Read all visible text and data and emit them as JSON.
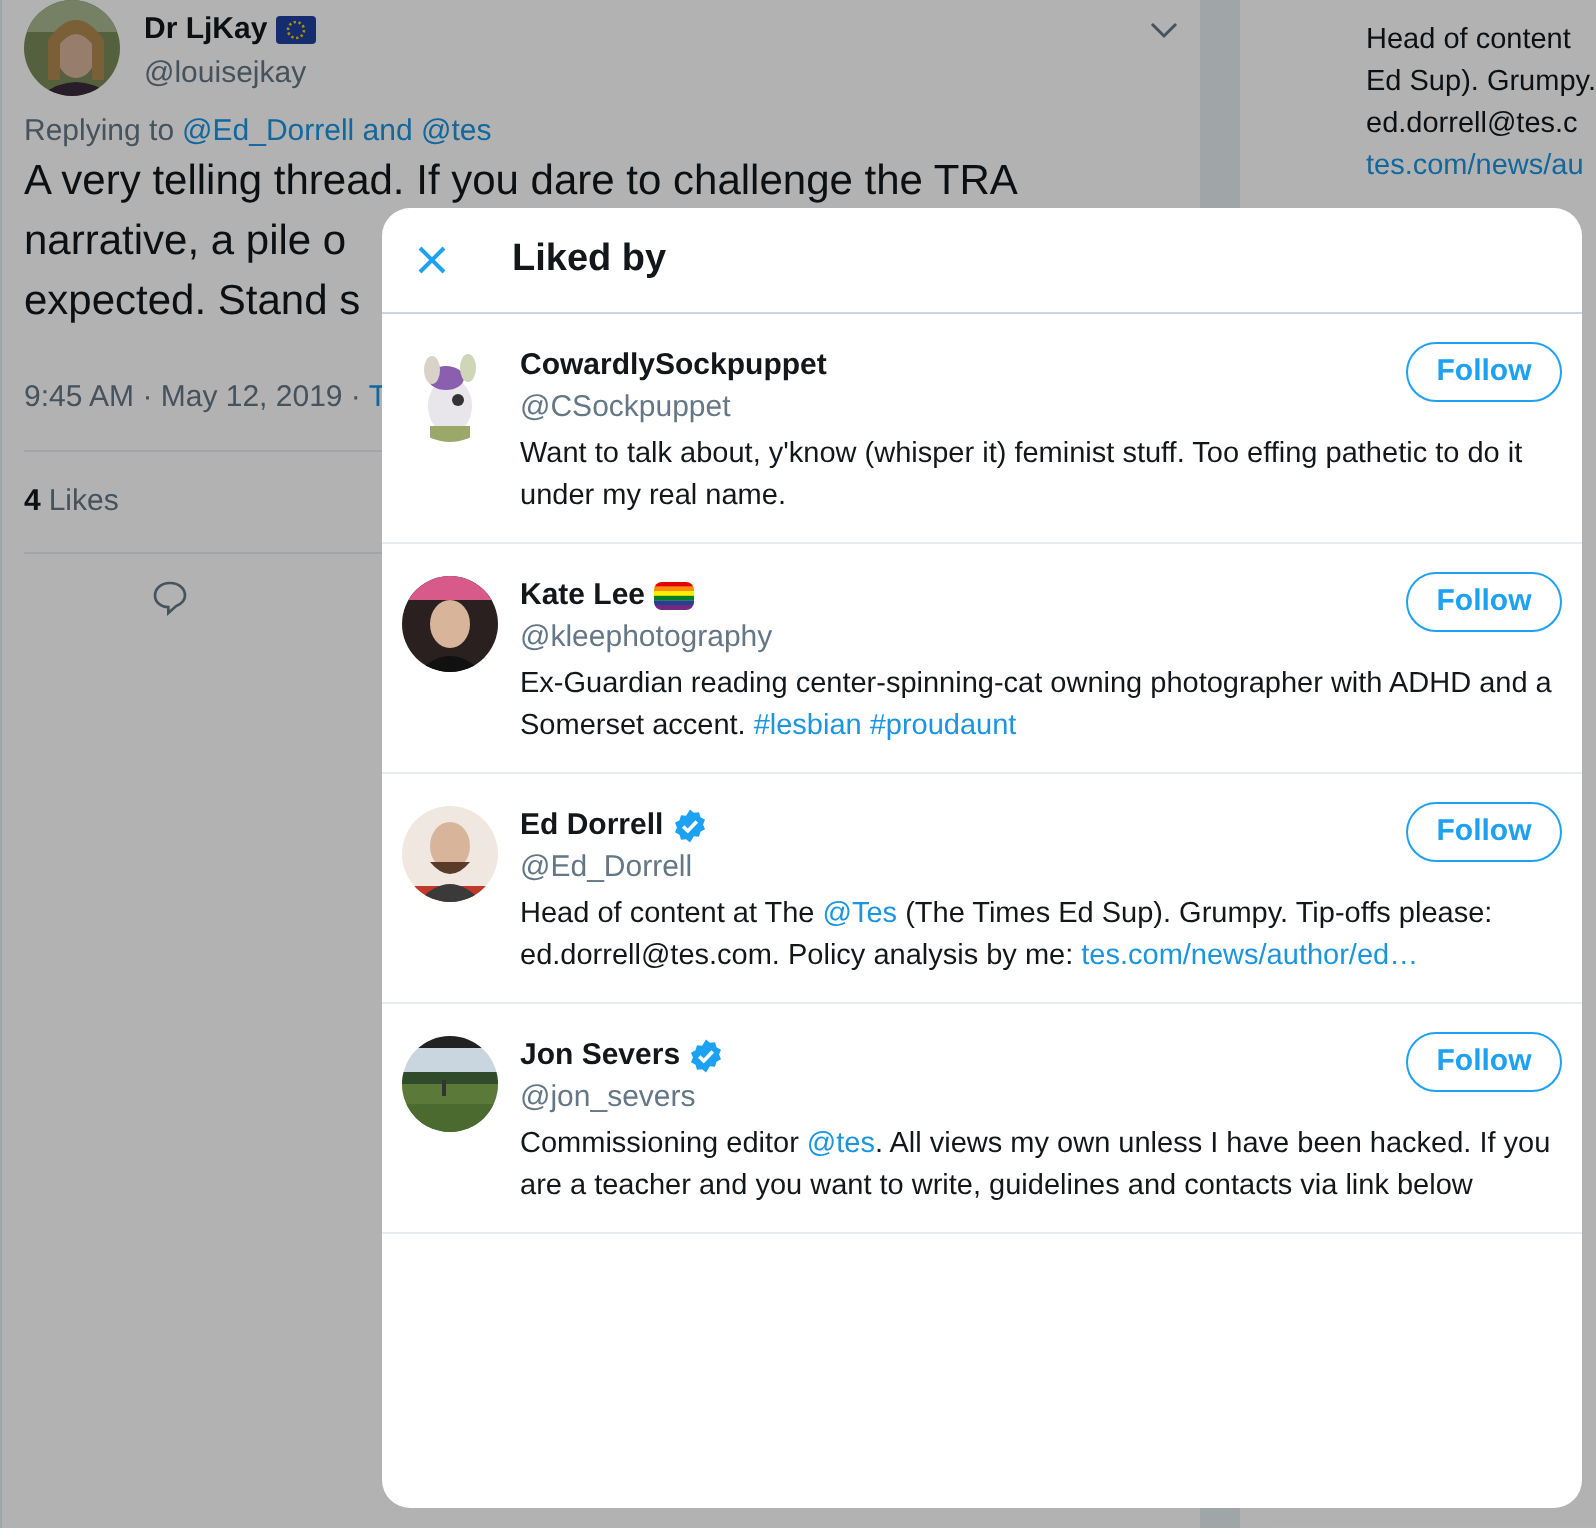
{
  "background_tweet": {
    "author": {
      "name": "Dr LjKay",
      "handle": "@louisejkay"
    },
    "replying_prefix": "Replying to",
    "replying_to": "@Ed_Dorrell and @tes",
    "text_lines": [
      "A very telling thread. If you dare to challenge the TRA",
      "narrative, a pile o",
      "expected. Stand s"
    ],
    "meta": "9:45 AM · May 12, 2019 ·",
    "source": "T",
    "likes_count": "4",
    "likes_label": "Likes"
  },
  "right_column": {
    "lines": [
      "Head of content",
      "Ed Sup). Grumpy.",
      "ed.dorrell@tes.c"
    ],
    "link": "tes.com/news/au"
  },
  "modal": {
    "title": "Liked by",
    "users": [
      {
        "name": "CowardlySockpuppet",
        "handle": "@CSockpuppet",
        "verified": false,
        "button": "Follow",
        "bio": [
          {
            "text": "Want to talk about, y'know (whisper it) feminist stuff. Too effing pathetic to do it under my real name.",
            "link": false
          }
        ]
      },
      {
        "name": "Kate Lee",
        "handle": "@kleephotography",
        "verified": false,
        "button": "Follow",
        "bio": [
          {
            "text": "Ex-Guardian reading center-spinning-cat owning photographer with ADHD and a Somerset accent.",
            "link": false
          },
          {
            "text": "#lesbian",
            "link": true
          },
          {
            "text": "#proudaunt",
            "link": true
          }
        ]
      },
      {
        "name": "Ed Dorrell",
        "handle": "@Ed_Dorrell",
        "verified": true,
        "button": "Follow",
        "bio": [
          {
            "text": "Head of content at The",
            "link": false
          },
          {
            "text": "@Tes",
            "link": true
          },
          {
            "text": "(The Times Ed Sup). Grumpy. Tip-offs please: ed.dorrell@tes.com. Policy analysis by me:",
            "link": false
          },
          {
            "text": "tes.com/news/author/ed…",
            "link": true
          }
        ]
      },
      {
        "name": "Jon Severs",
        "handle": "@jon_severs",
        "verified": true,
        "button": "Follow",
        "bio": [
          {
            "text": "Commissioning editor",
            "link": false
          },
          {
            "text": "@tes",
            "link": true
          },
          {
            "text": ". All views my own unless I have been hacked. If you are a teacher and you want to write, guidelines and contacts via link below",
            "link": false
          }
        ]
      }
    ]
  }
}
